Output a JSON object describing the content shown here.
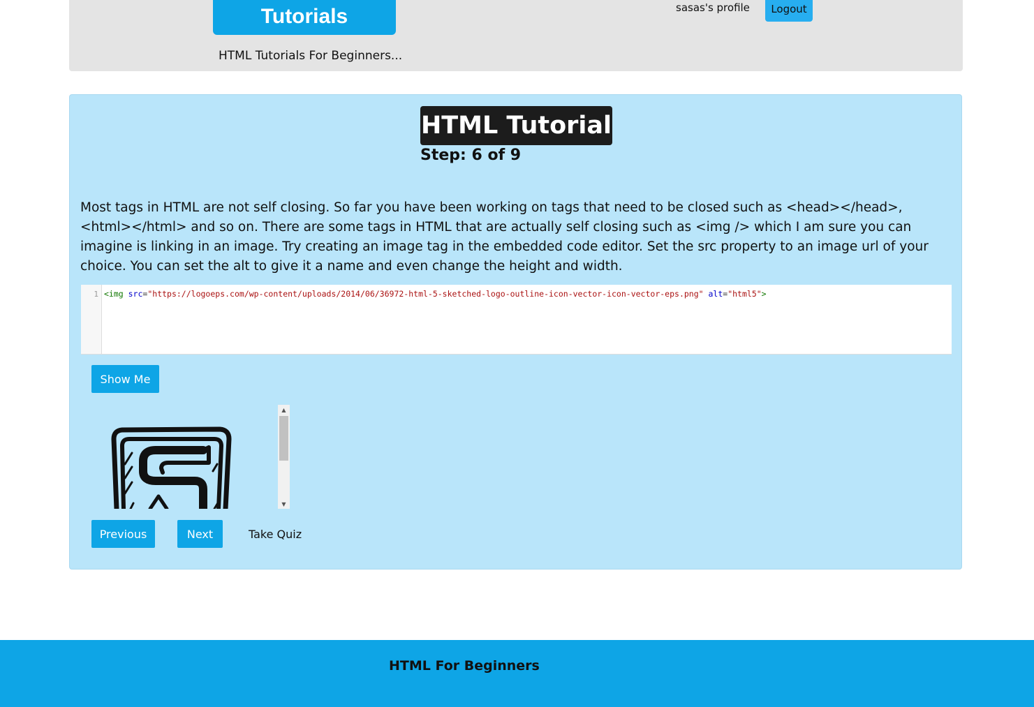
{
  "header": {
    "brand_label": "Tutorials",
    "tagline": "HTML Tutorials For Beginners...",
    "profile_link": "sasas's profile",
    "logout_label": "Logout"
  },
  "tutorial": {
    "title": "HTML Tutorial",
    "step": "Step: 6 of 9",
    "description": "Most tags in HTML are not self closing. So far you have been working on tags that need to be closed such as <head></head>, <html></html> and so on. There are some tags in HTML that are actually self closing such as <img /> which I am sure you can imagine is linking in an image. Try creating an image tag in the embedded code editor. Set the src property to an image url of your choice. You can set the alt to give it a name and even change the height and width."
  },
  "editor": {
    "line_number": "1",
    "tokens": {
      "open": "<img",
      "src_attr": " src",
      "eq1": "=",
      "src_value": "\"https://logoeps.com/wp-content/uploads/2014/06/36972-html-5-sketched-logo-outline-icon-vector-icon-vector-eps.png\"",
      "alt_attr": " alt",
      "eq2": "=",
      "alt_value": "\"html5\"",
      "close": ">"
    }
  },
  "actions": {
    "show_me": "Show Me",
    "previous": "Previous",
    "next": "Next",
    "take_quiz": "Take Quiz"
  },
  "preview": {
    "image_icon": "html5-sketched-logo-icon",
    "scroll_up": "▲",
    "scroll_down": "▼"
  },
  "footer": {
    "title": "HTML For Beginners"
  },
  "colors": {
    "accent": "#0ea5e6",
    "card_bg": "#b9e5fa",
    "header_bg": "#e4e4e4",
    "title_bg": "#1c1c1c"
  }
}
